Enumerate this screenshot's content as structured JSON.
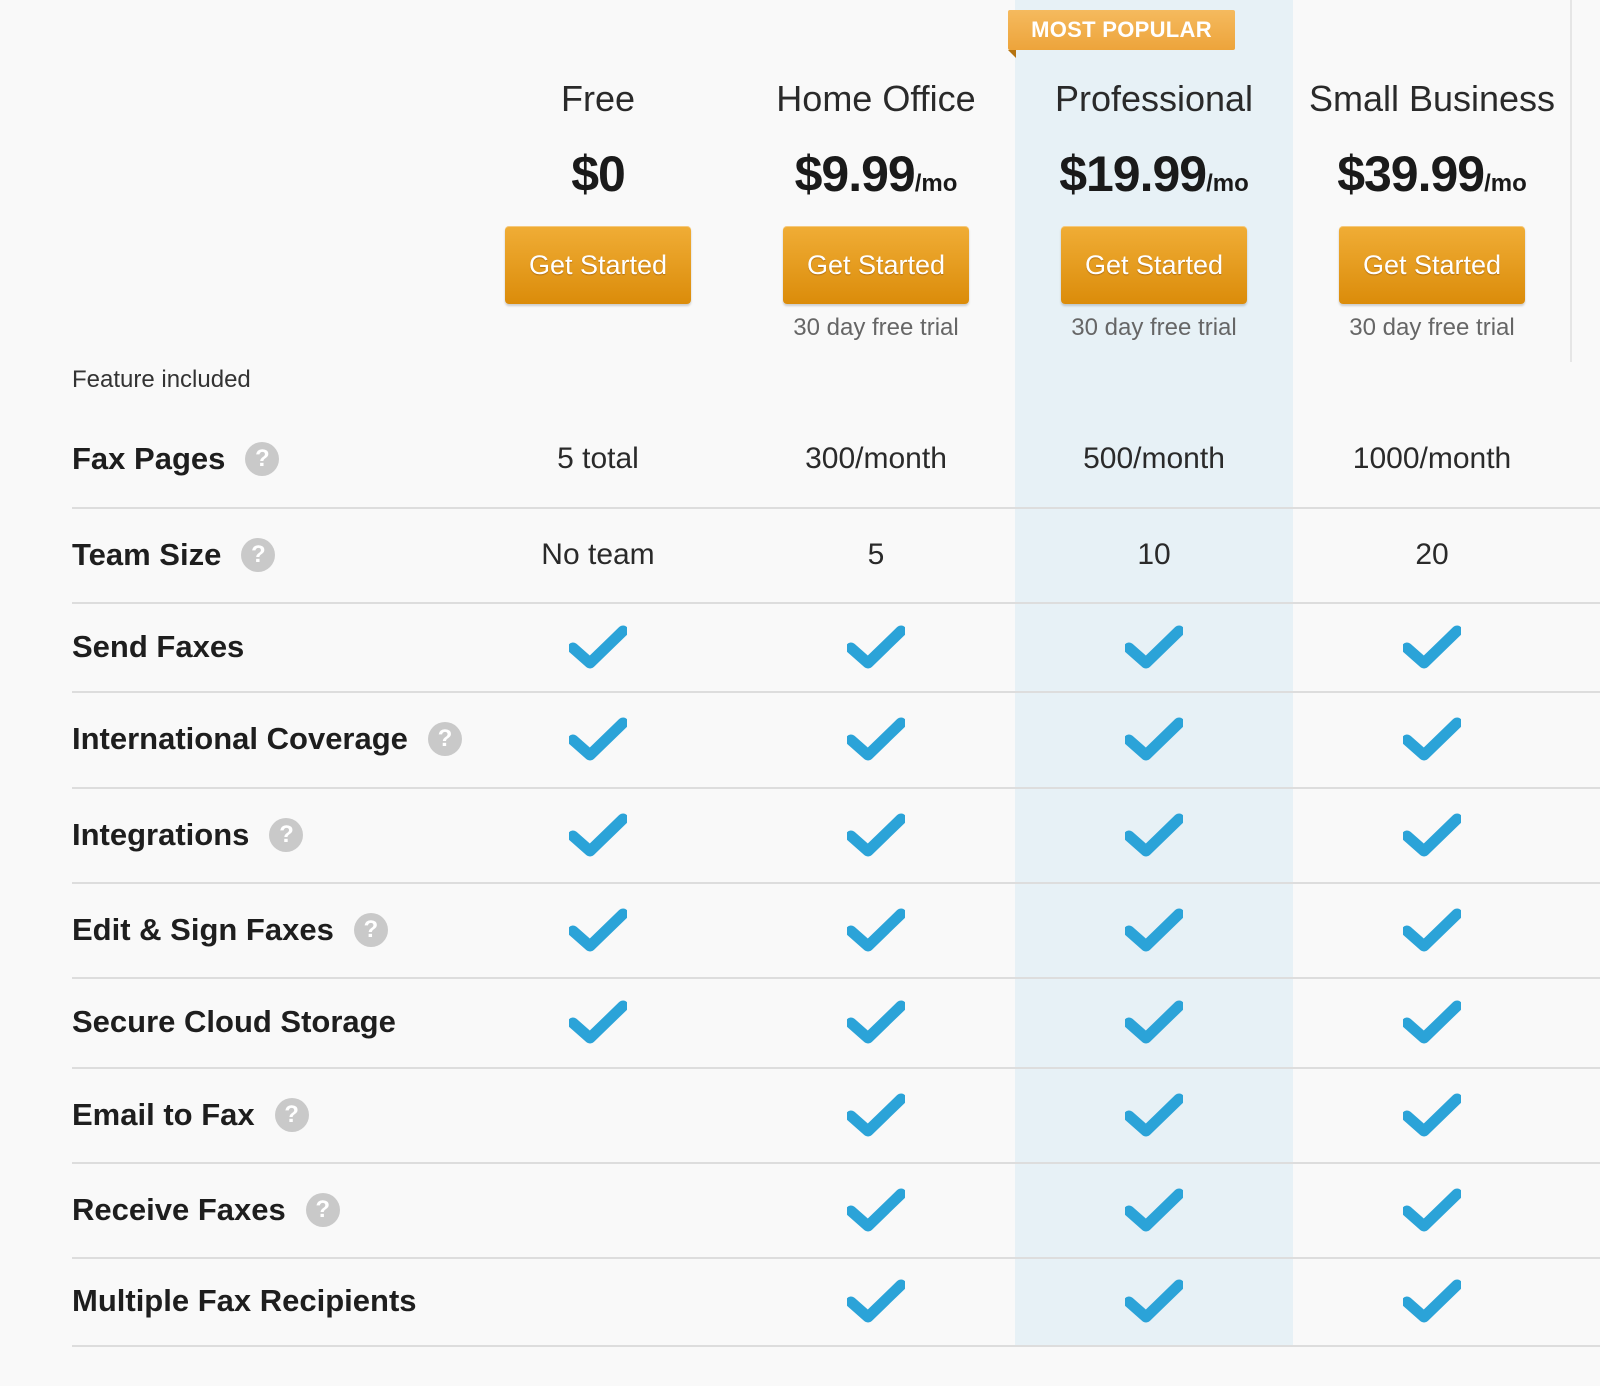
{
  "badge": {
    "label": "MOST POPULAR"
  },
  "colors": {
    "accent_button": "#e29812",
    "highlight_column": "#e7f1f6",
    "check": "#2ba3d8",
    "help_icon": "#c9c9c9"
  },
  "plans": [
    {
      "name": "Free",
      "price": "$0",
      "per": "",
      "button": "Get Started",
      "trial": ""
    },
    {
      "name": "Home Office",
      "price": "$9.99",
      "per": "/mo",
      "button": "Get Started",
      "trial": "30 day free trial"
    },
    {
      "name": "Professional",
      "price": "$19.99",
      "per": "/mo",
      "button": "Get Started",
      "trial": "30 day free trial"
    },
    {
      "name": "Small Business",
      "price": "$39.99",
      "per": "/mo",
      "button": "Get Started",
      "trial": "30 day free trial"
    }
  ],
  "feature_heading": "Feature included",
  "help_glyph": "?",
  "features": [
    {
      "name": "Fax Pages",
      "help": true,
      "values": [
        "5 total",
        "300/month",
        "500/month",
        "1000/month"
      ]
    },
    {
      "name": "Team Size",
      "help": true,
      "values": [
        "No team",
        "5",
        "10",
        "20"
      ]
    },
    {
      "name": "Send Faxes",
      "help": false,
      "values": [
        true,
        true,
        true,
        true
      ]
    },
    {
      "name": "International Coverage",
      "help": true,
      "values": [
        true,
        true,
        true,
        true
      ]
    },
    {
      "name": "Integrations",
      "help": true,
      "values": [
        true,
        true,
        true,
        true
      ]
    },
    {
      "name": "Edit & Sign Faxes",
      "help": true,
      "values": [
        true,
        true,
        true,
        true
      ]
    },
    {
      "name": "Secure Cloud Storage",
      "help": false,
      "values": [
        true,
        true,
        true,
        true
      ]
    },
    {
      "name": "Email to Fax",
      "help": true,
      "values": [
        false,
        true,
        true,
        true
      ]
    },
    {
      "name": "Receive Faxes",
      "help": true,
      "values": [
        false,
        true,
        true,
        true
      ]
    },
    {
      "name": "Multiple Fax Recipients",
      "help": false,
      "values": [
        false,
        true,
        true,
        true
      ]
    }
  ]
}
